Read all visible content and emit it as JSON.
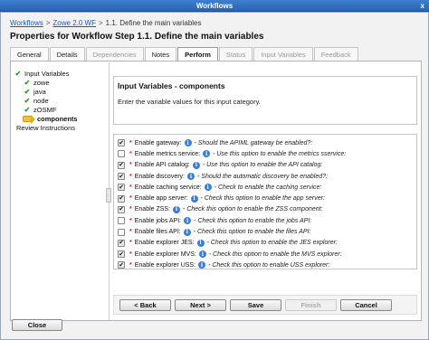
{
  "window": {
    "title": "Workflows",
    "close_glyph": "x"
  },
  "breadcrumb": [
    {
      "label": "Workflows",
      "link": true
    },
    {
      "label": "Zowe 2.0 WF",
      "link": true
    },
    {
      "label": "1.1. Define the main variables",
      "link": false
    }
  ],
  "breadcrumb_separator": ">",
  "heading": "Properties for Workflow Step 1.1. Define the main variables",
  "tabs": [
    {
      "label": "General",
      "state": "normal"
    },
    {
      "label": "Details",
      "state": "normal"
    },
    {
      "label": "Dependencies",
      "state": "disabled"
    },
    {
      "label": "Notes",
      "state": "normal"
    },
    {
      "label": "Perform",
      "state": "active"
    },
    {
      "label": "Status",
      "state": "disabled"
    },
    {
      "label": "Input Variables",
      "state": "disabled"
    },
    {
      "label": "Feedback",
      "state": "disabled"
    }
  ],
  "nav": {
    "items": [
      {
        "label": "Input Variables",
        "icon": "check-icon",
        "indent": false
      },
      {
        "label": "zowe",
        "icon": "check-icon",
        "indent": true
      },
      {
        "label": "java",
        "icon": "check-icon",
        "indent": true
      },
      {
        "label": "node",
        "icon": "check-icon",
        "indent": true
      },
      {
        "label": "zOSMF",
        "icon": "check-icon",
        "indent": true
      },
      {
        "label": "components",
        "icon": "arrow-right-icon",
        "indent": true,
        "current": true
      },
      {
        "label": "Review Instructions",
        "icon": "",
        "indent": false
      }
    ]
  },
  "category": {
    "title": "Input Variables - components",
    "description": "Enter the variable values for this input category."
  },
  "variables": [
    {
      "label": "Enable gateway:",
      "hint": "- Should the APIML gateway be enabled?:",
      "checked": true
    },
    {
      "label": "Enable metrics service:",
      "hint": "- Use this option to enable the metrics sservice:",
      "checked": false
    },
    {
      "label": "Enable API catalog:",
      "hint": "- Use this option to enable the API catalog:",
      "checked": true
    },
    {
      "label": "Enable discovery:",
      "hint": "- Should the automatic discovery be enabled?:",
      "checked": true
    },
    {
      "label": "Enable caching service:",
      "hint": "- Check to enable the caching service:",
      "checked": true
    },
    {
      "label": "Enable app server:",
      "hint": "- Check this option to enable the app server:",
      "checked": true
    },
    {
      "label": "Enable ZSS:",
      "hint": "- Check this option to enable the ZSS component:",
      "checked": true
    },
    {
      "label": "Enable jobs API:",
      "hint": "- Check this option to enable the jobs API:",
      "checked": false
    },
    {
      "label": "Enable files API:",
      "hint": "- Check this option to enable the files API:",
      "checked": false
    },
    {
      "label": "Enable explorer JES:",
      "hint": "- Check this option to enable the JES explorer:",
      "checked": true
    },
    {
      "label": "Enable explorer MVS:",
      "hint": "- Check this option to enable the MVS explorer:",
      "checked": true
    },
    {
      "label": "Enable explorer USS:",
      "hint": "- Check this option to enable USS explorer:",
      "checked": true
    }
  ],
  "required_marker": "*",
  "info_glyph": "i",
  "checkbox_checked_glyph": "✔",
  "buttons": [
    {
      "label": "< Back",
      "enabled": true
    },
    {
      "label": "Next >",
      "enabled": true
    },
    {
      "label": "Save",
      "enabled": true
    },
    {
      "label": "Finish",
      "enabled": false
    },
    {
      "label": "Cancel",
      "enabled": true
    }
  ],
  "close_button": "Close"
}
